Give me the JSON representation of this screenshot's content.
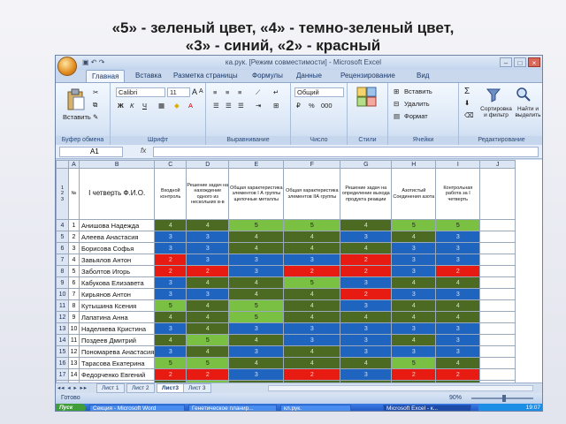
{
  "slide": {
    "title_line1": "«5» - зеленый цвет, «4» - темно-зеленый цвет,",
    "title_line2": "«3» - синий, «2» - красный"
  },
  "window": {
    "title": "ка.рук. [Режим совместимости] - Microsoft Excel",
    "controls": [
      "–",
      "□",
      "×"
    ]
  },
  "ribbon_tabs": [
    "Главная",
    "Вставка",
    "Разметка страницы",
    "Формулы",
    "Данные",
    "Рецензирование",
    "Вид"
  ],
  "ribbon": {
    "clipboard": {
      "paste": "Вставить",
      "label": "Буфер обмена"
    },
    "font": {
      "name": "Calibri",
      "size": "11",
      "bold": "Ж",
      "italic": "К",
      "underline": "Ч",
      "grow": "A",
      "shrink": "A",
      "label": "Шрифт"
    },
    "alignment": {
      "label": "Выравнивание"
    },
    "number": {
      "format": "Общий",
      "label": "Число",
      "percent": "%",
      "thousands": "000"
    },
    "styles": {
      "label": "Стили"
    },
    "cells": {
      "insert": "Вставить",
      "delete": "Удалить",
      "format": "Формат",
      "label": "Ячейки"
    },
    "editing": {
      "sum": "Σ",
      "sort": "Сортировка и фильтр",
      "find": "Найти и выделить",
      "label": "Редактирование"
    }
  },
  "formula_bar": {
    "name_box": "A1",
    "fx": "fx",
    "value": ""
  },
  "columns": [
    "A",
    "B",
    "C",
    "D",
    "E",
    "F",
    "G",
    "H",
    "I",
    "J"
  ],
  "header_row": {
    "num": "№",
    "name": "I четверть Ф.И.О.",
    "c": "Входной контроль",
    "d": "Решение задач на нахождение одного из нескольких в-в",
    "e": "Общая характеристика элементов I А группы щелочные металлы",
    "f": "Общая характеристика элементов IIА группы",
    "g": "Решение задач на определение выхода продукта реакции",
    "h": "Азотистый Соединения азота",
    "i": "Контрольная работа за I четверть"
  },
  "students": [
    {
      "row": "4",
      "num": "1",
      "name": "Анишова Надежда",
      "grades": [
        4,
        4,
        5,
        5,
        4,
        5,
        5
      ]
    },
    {
      "row": "5",
      "num": "2",
      "name": "Алеева Анастасия",
      "grades": [
        3,
        3,
        4,
        4,
        3,
        4,
        3
      ]
    },
    {
      "row": "6",
      "num": "3",
      "name": "Борисова Софья",
      "grades": [
        3,
        3,
        4,
        4,
        4,
        3,
        3
      ]
    },
    {
      "row": "7",
      "num": "4",
      "name": "Завьялов Антон",
      "grades": [
        2,
        3,
        3,
        3,
        2,
        3,
        3
      ]
    },
    {
      "row": "8",
      "num": "5",
      "name": "Заболтов Игорь",
      "grades": [
        2,
        2,
        3,
        2,
        2,
        3,
        2
      ]
    },
    {
      "row": "9",
      "num": "6",
      "name": "Кабукова Елизавета",
      "grades": [
        3,
        4,
        4,
        5,
        3,
        4,
        4
      ]
    },
    {
      "row": "10",
      "num": "7",
      "name": "Кирьянов Антон",
      "grades": [
        3,
        3,
        4,
        4,
        2,
        3,
        3
      ]
    },
    {
      "row": "11",
      "num": "8",
      "name": "Кутышина Ксения",
      "grades": [
        5,
        4,
        5,
        4,
        3,
        4,
        4
      ]
    },
    {
      "row": "12",
      "num": "9",
      "name": "Лапатина Анна",
      "grades": [
        4,
        4,
        5,
        4,
        4,
        4,
        4
      ]
    },
    {
      "row": "13",
      "num": "10",
      "name": "Наделяева Кристина",
      "grades": [
        3,
        4,
        3,
        3,
        3,
        3,
        3
      ]
    },
    {
      "row": "14",
      "num": "11",
      "name": "Поздеев Дмитрий",
      "grades": [
        4,
        5,
        4,
        3,
        3,
        4,
        3
      ]
    },
    {
      "row": "15",
      "num": "12",
      "name": "Пономарева Анастасия",
      "grades": [
        3,
        4,
        3,
        4,
        3,
        3,
        3
      ]
    },
    {
      "row": "16",
      "num": "13",
      "name": "Тарасова Екатерина",
      "grades": [
        5,
        5,
        4,
        4,
        4,
        5,
        4
      ]
    },
    {
      "row": "17",
      "num": "14",
      "name": "Федорченко Евгений",
      "grades": [
        2,
        2,
        3,
        2,
        3,
        2,
        2
      ]
    },
    {
      "row": "18",
      "num": "15",
      "name": "Леферова Алёна",
      "grades": [
        4,
        5,
        4,
        4,
        4,
        4,
        4
      ]
    }
  ],
  "grade_colors": {
    "5": "#7ac143",
    "4": "#4c6a22",
    "3": "#1f64bf",
    "2": "#e81b13"
  },
  "sheet_tabs": [
    "Лист 1",
    "Лист 2",
    "Лист3",
    "Лист 3"
  ],
  "active_sheet": "Лист3",
  "status": {
    "ready": "Готово",
    "zoom": "90%"
  },
  "taskbar": {
    "start": "Пуск",
    "items": [
      "Секция - Microsoft Word",
      "Генетическое планир...",
      "кл.рук.",
      "Microsoft Excel - к..."
    ],
    "active": "Microsoft Excel - к...",
    "clock": "19:07"
  }
}
